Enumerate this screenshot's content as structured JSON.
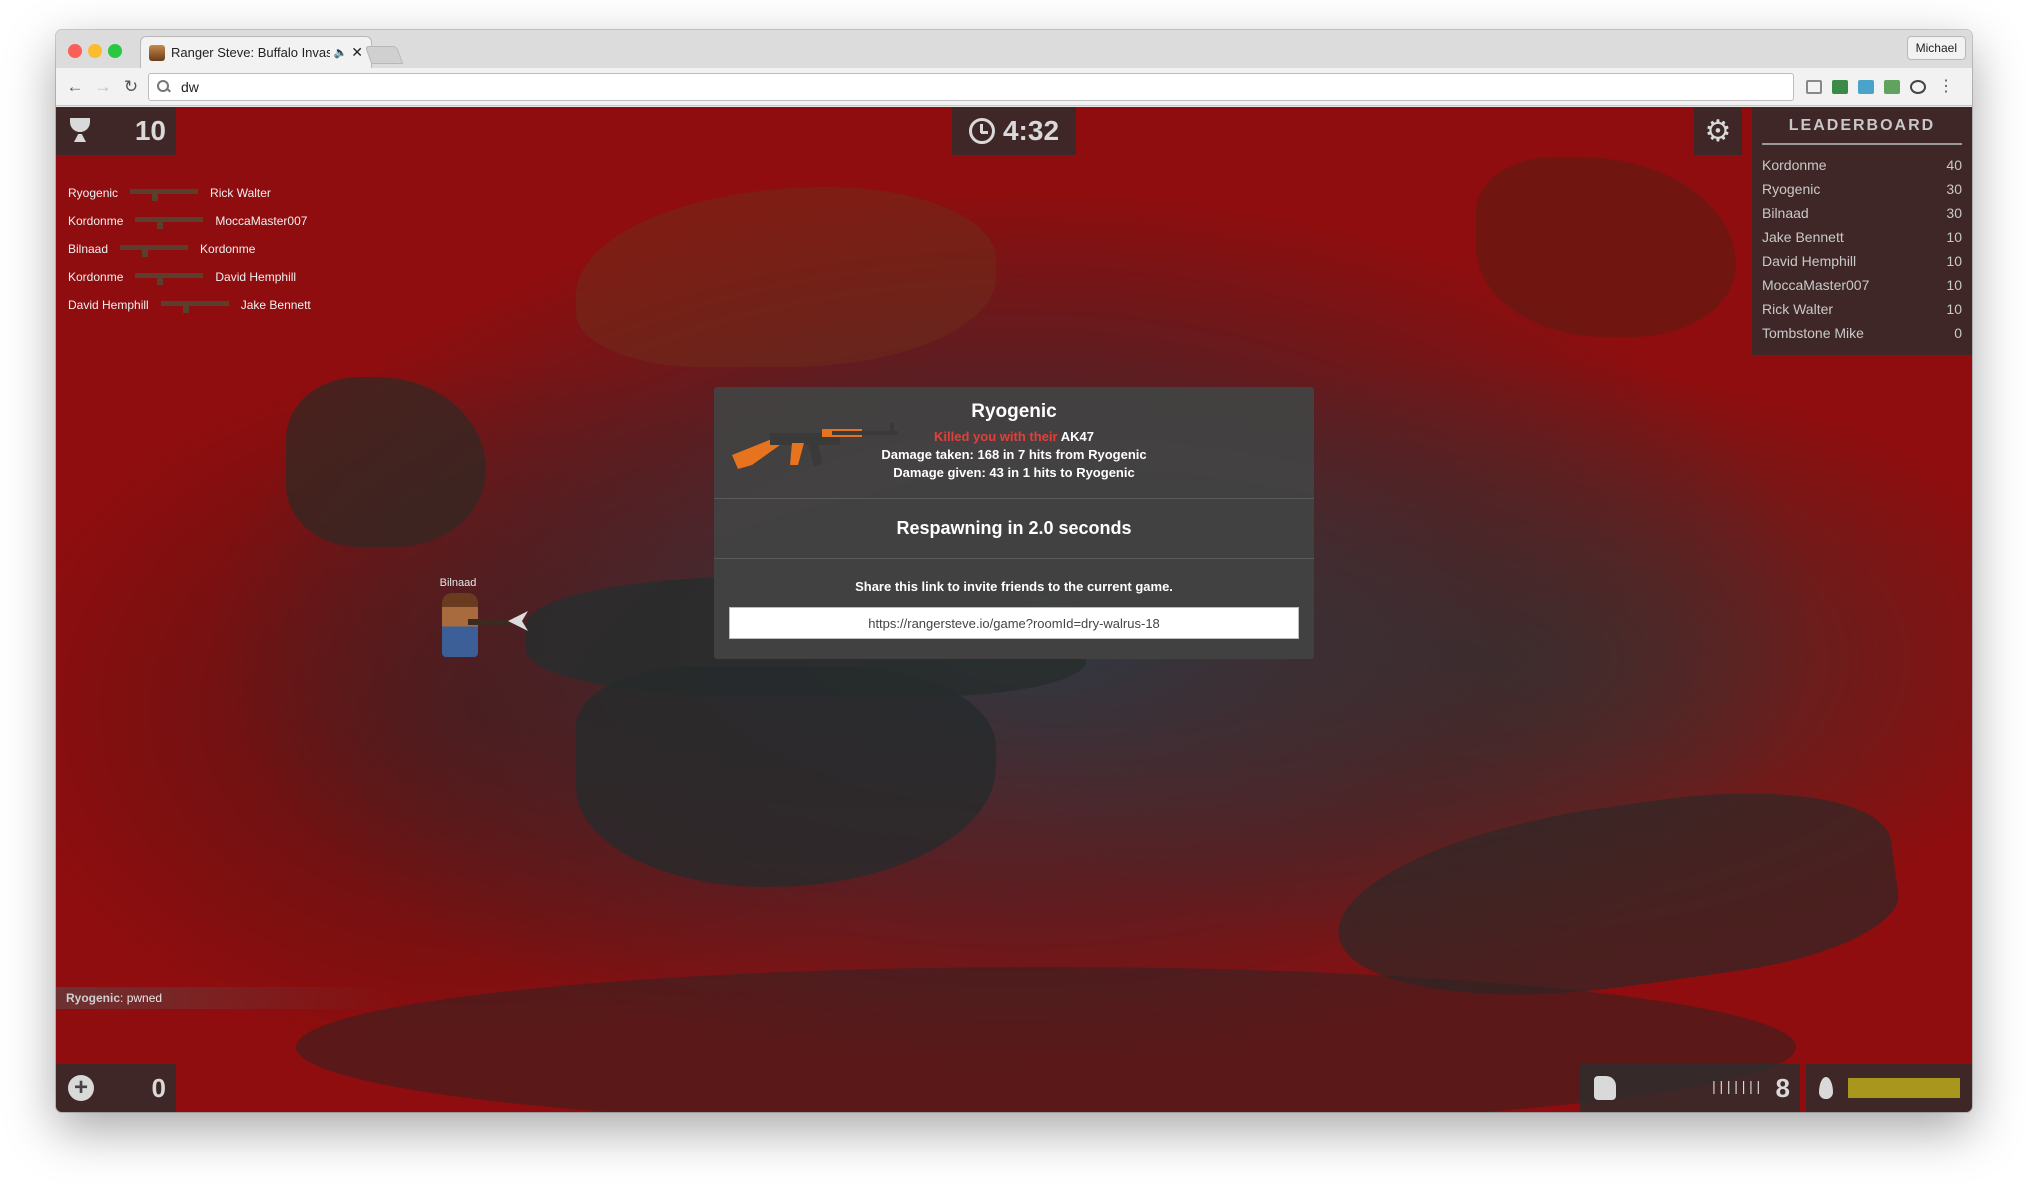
{
  "browser": {
    "tab_title": "Ranger Steve: Buffalo Invas",
    "profile_name": "Michael",
    "address": "dw",
    "nav": {
      "back": "←",
      "forward": "→",
      "reload": "↻"
    },
    "tab_speaker_icon": "🔈",
    "tab_close_icon": "✕",
    "menu_icon": "⋮"
  },
  "hud": {
    "score": "10",
    "timer": "4:32",
    "health": "0",
    "ammo": "8",
    "ammo_bars": "|||||||",
    "fuel_fraction": 1.0,
    "fuel_color": "#a9961c",
    "settings_icon": "⚙"
  },
  "leaderboard": {
    "title": "LEADERBOARD",
    "rows": [
      {
        "name": "Kordonme",
        "score": "40"
      },
      {
        "name": "Ryogenic",
        "score": "30"
      },
      {
        "name": "Bilnaad",
        "score": "30"
      },
      {
        "name": "Jake Bennett",
        "score": "10"
      },
      {
        "name": "David Hemphill",
        "score": "10"
      },
      {
        "name": "MoccaMaster007",
        "score": "10"
      },
      {
        "name": "Rick Walter",
        "score": "10"
      },
      {
        "name": "Tombstone Mike",
        "score": "0"
      }
    ]
  },
  "killfeed": [
    {
      "killer": "Ryogenic",
      "victim": "Rick Walter"
    },
    {
      "killer": "Kordonme",
      "victim": "MoccaMaster007"
    },
    {
      "killer": "Bilnaad",
      "victim": "Kordonme"
    },
    {
      "killer": "Kordonme",
      "victim": "David Hemphill"
    },
    {
      "killer": "David Hemphill",
      "victim": "Jake Bennett"
    }
  ],
  "player": {
    "name": "Bilnaad"
  },
  "death_modal": {
    "killer": "Ryogenic",
    "killed_prefix": "Killed you with their",
    "weapon": "AK47",
    "damage_taken_prefix": "Damage taken:",
    "damage_taken_amount": "168",
    "damage_taken_in": "in",
    "damage_taken_hits": "7 hits",
    "damage_taken_from": "from",
    "damage_taken_player": "Ryogenic",
    "damage_given_prefix": "Damage given:",
    "damage_given_amount": "43",
    "damage_given_in": "in",
    "damage_given_hits": "1 hits",
    "damage_given_to": "to",
    "damage_given_player": "Ryogenic",
    "respawn_text": "Respawning in 2.0 seconds",
    "share_text": "Share this link to invite friends to the current game.",
    "share_link": "https://rangersteve.io/game?roomId=dry-walrus-18"
  },
  "chat": {
    "author": "Ryogenic",
    "message": "pwned"
  },
  "colors": {
    "blood_overlay": "#8f0d0e",
    "gun_orange": "#e8731e",
    "killed_red": "#e0403a"
  }
}
